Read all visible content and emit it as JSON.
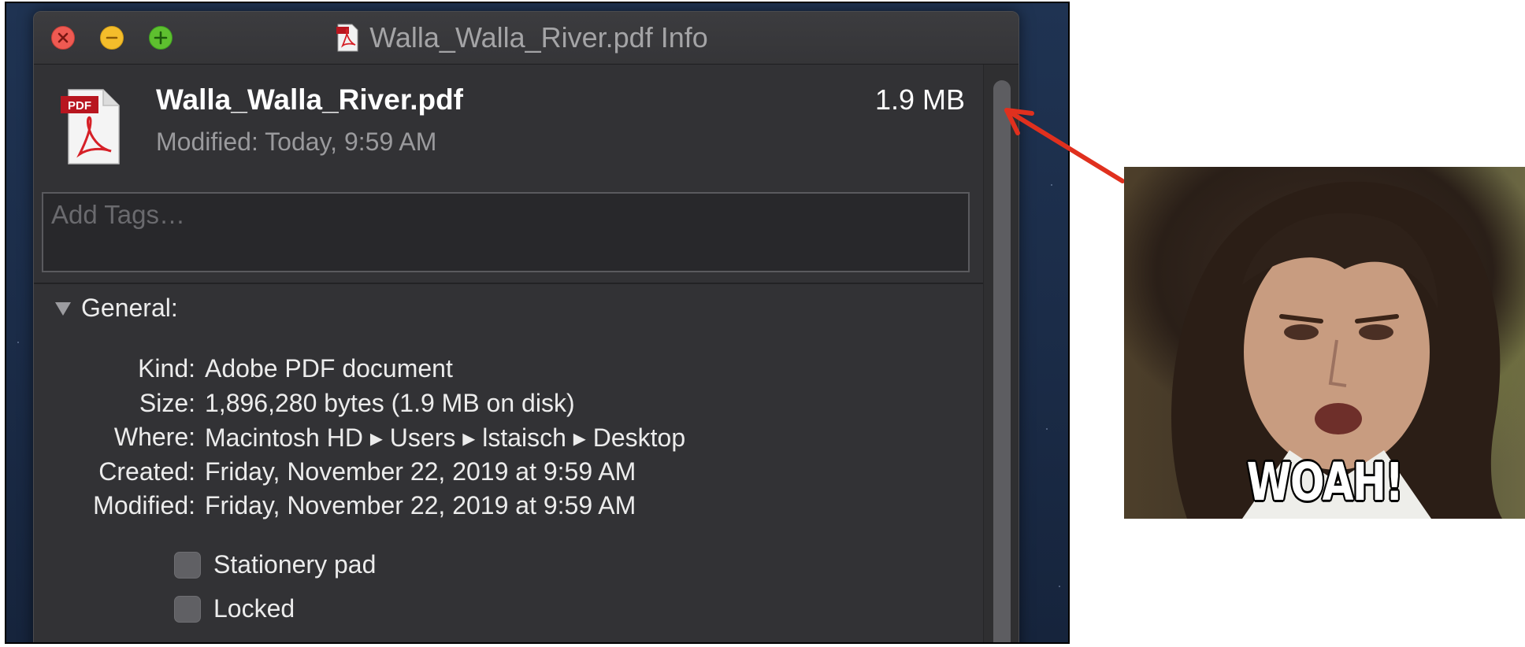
{
  "window": {
    "title": "Walla_Walla_River.pdf Info"
  },
  "file": {
    "name": "Walla_Walla_River.pdf",
    "size": "1.9 MB",
    "modified": "Modified: Today, 9:59 AM",
    "icon": "pdf-document-icon",
    "icon_badge": "PDF"
  },
  "tags": {
    "placeholder": "Add Tags…",
    "value": ""
  },
  "general": {
    "heading": "General:",
    "expanded": true,
    "rows": [
      {
        "label": "Kind:",
        "value": "Adobe PDF document"
      },
      {
        "label": "Size:",
        "value": "1,896,280 bytes (1.9 MB on disk)"
      },
      {
        "label": "Where:",
        "value": "Macintosh HD ▸ Users ▸ lstaisch ▸ Desktop"
      },
      {
        "label": "Created:",
        "value": "Friday, November 22, 2019 at 9:59 AM"
      },
      {
        "label": "Modified:",
        "value": "Friday, November 22, 2019 at 9:59 AM"
      }
    ],
    "checkboxes": [
      {
        "label": "Stationery pad",
        "checked": false
      },
      {
        "label": "Locked",
        "checked": false
      }
    ]
  },
  "annotation": {
    "arrow_color": "#e0301e",
    "meme_caption": "WOAH!"
  },
  "colors": {
    "window_bg": "#323235",
    "close": "#ee5a52",
    "minimize": "#f4bd2b",
    "zoom": "#5ec02f"
  }
}
